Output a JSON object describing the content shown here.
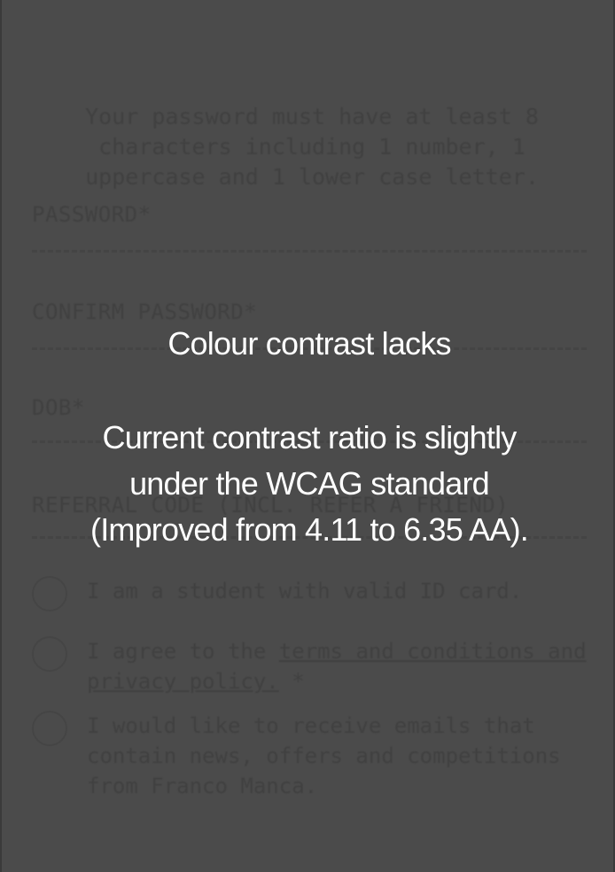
{
  "form": {
    "password_hint": "Your password must have at least 8 characters including 1 number, 1 uppercase and 1 lower case letter.",
    "fields": [
      {
        "label": "PASSWORD*"
      },
      {
        "label": "CONFIRM PASSWORD*"
      },
      {
        "label": "DOB*"
      },
      {
        "label": "REFERRAL CODE (INCL. REFER A FRIEND)"
      }
    ],
    "checkboxes": {
      "student": {
        "text": "I am a student with valid ID card."
      },
      "terms": {
        "prefix": "I agree to the ",
        "link": "terms and conditions and privacy policy.",
        "suffix": " *"
      },
      "emails": {
        "text": "I would like to receive emails that contain news, offers and competitions from Franco Manca."
      }
    }
  },
  "overlay": {
    "heading": "Colour contrast lacks",
    "body_lines": [
      "Current contrast ratio is slightly",
      "under the WCAG standard",
      "(Improved from 4.11 to 6.35 AA)."
    ]
  },
  "colors": {
    "background": "#4b4b4b",
    "overlay_text": "#ffffff",
    "dim_text": "#3f3f3f"
  }
}
